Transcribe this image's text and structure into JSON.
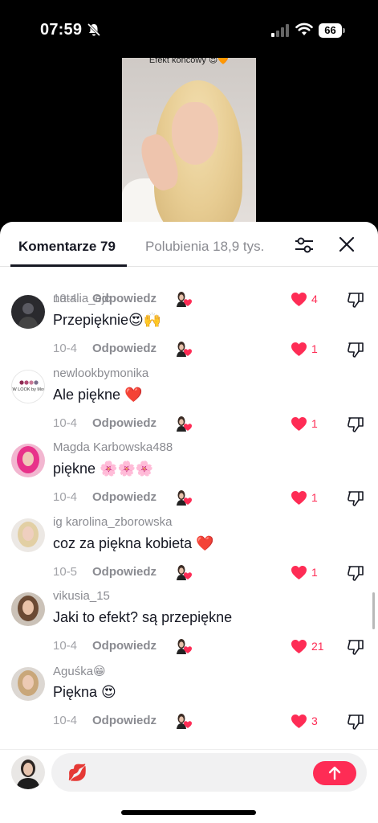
{
  "status_bar": {
    "time": "07:59",
    "battery": "66"
  },
  "video": {
    "caption": "Efekt końcowy 😍🧡"
  },
  "tabs": {
    "comments": "Komentarze 79",
    "likes": "Polubienia 18,9 tys."
  },
  "colors": {
    "accent": "#fe2c55",
    "text": "#161823",
    "muted": "#8a8b91"
  },
  "comments": [
    {
      "user": "",
      "text": "",
      "date": "10-4",
      "reply": "Odpowiedz",
      "likes": "4",
      "avatar": "none"
    },
    {
      "user": "natalia_ejc",
      "text": "Przepięknie😍🙌",
      "date": "10-4",
      "reply": "Odpowiedz",
      "likes": "1",
      "avatar": "dark-photo"
    },
    {
      "user": "newlookbymonika",
      "text": "Ale piękne ❤️",
      "date": "10-4",
      "reply": "Odpowiedz",
      "likes": "1",
      "avatar": "logo"
    },
    {
      "user": "Magda Karbowska488",
      "text": "piękne 🌸🌸🌸",
      "date": "10-4",
      "reply": "Odpowiedz",
      "likes": "1",
      "avatar": "pink-hair"
    },
    {
      "user": "ig karolina_zborowska",
      "text": "coz za piękna kobieta ❤️",
      "date": "10-5",
      "reply": "Odpowiedz",
      "likes": "1",
      "avatar": "blonde"
    },
    {
      "user": "vikusia_15",
      "text": "Jaki to efekt? są przepiękne",
      "date": "10-4",
      "reply": "Odpowiedz",
      "likes": "21",
      "avatar": "brunette"
    },
    {
      "user": "Aguśka😁",
      "text": "Piękna 😍",
      "date": "10-4",
      "reply": "Odpowiedz",
      "likes": "3",
      "avatar": "blonde2"
    }
  ],
  "composer": {
    "emoji": "💋"
  },
  "avatar_logo_text": "NEW LOOK by Monika"
}
